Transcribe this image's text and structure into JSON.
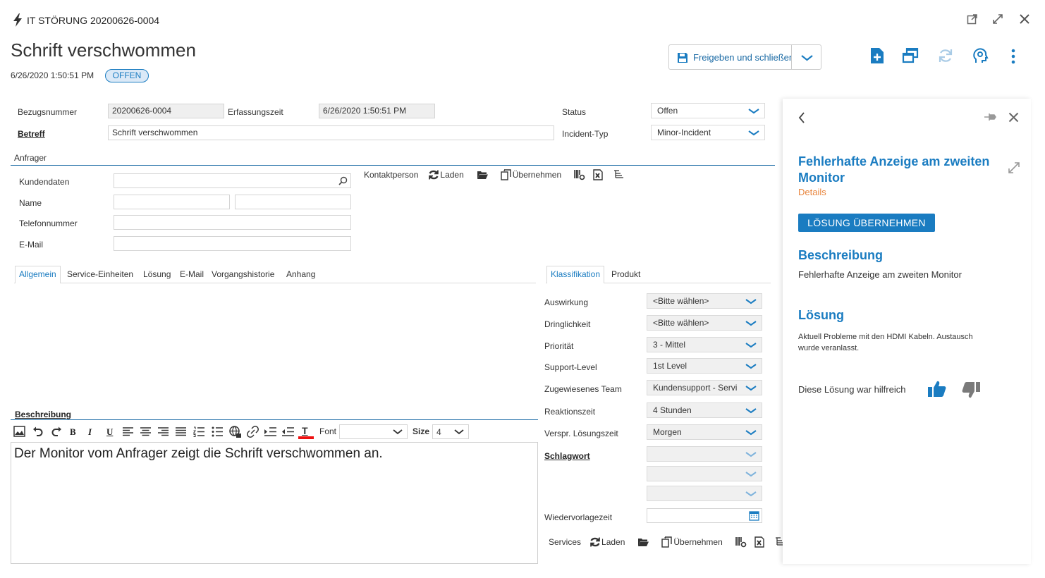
{
  "header": {
    "breadcrumb": "IT STÖRUNG 20200626-0004",
    "title": "Schrift verschwommen",
    "timestamp": "6/26/2020 1:50:51 PM",
    "status_badge": "OFFEN",
    "save_button": "Freigeben und schließen"
  },
  "colors": {
    "accent": "#1a7cc1",
    "badge_bg": "#dbe9f7",
    "badge_border": "#1a7cc1",
    "side_orange": "#e8853d"
  },
  "form": {
    "bezugsnummer_label": "Bezugsnummer",
    "bezugsnummer_value": "20200626-0004",
    "erfassungszeit_label": "Erfassungszeit",
    "erfassungszeit_value": "6/26/2020 1:50:51 PM",
    "betreff_label": "Betreff",
    "betreff_value": "Schrift verschwommen",
    "status_label": "Status",
    "status_value": "Offen",
    "incident_typ_label": "Incident-Typ",
    "incident_typ_value": "Minor-Incident"
  },
  "anfrager": {
    "section_label": "Anfrager",
    "kundendaten_label": "Kundendaten",
    "name_label": "Name",
    "telefon_label": "Telefonnummer",
    "email_label": "E-Mail",
    "kontakt_label": "Kontaktperson",
    "laden_label": "Laden",
    "uebernehmen_label": "Übernehmen"
  },
  "tabs_left": [
    "Allgemein",
    "Service-Einheiten",
    "Lösung",
    "E-Mail",
    "Vorgangshistorie",
    "Anhang"
  ],
  "tabs_right": [
    "Klassifikation",
    "Produkt"
  ],
  "beschreibung": {
    "label": "Beschreibung",
    "font_label": "Font",
    "size_label": "Size",
    "size_value": "4",
    "text": "Der Monitor vom Anfrager zeigt die Schrift verschwommen an."
  },
  "klassifikation": {
    "auswirkung_label": "Auswirkung",
    "auswirkung_value": "<Bitte wählen>",
    "dringlichkeit_label": "Dringlichkeit",
    "dringlichkeit_value": "<Bitte wählen>",
    "prioritaet_label": "Priorität",
    "prioritaet_value": "3 - Mittel",
    "support_label": "Support-Level",
    "support_value": "1st Level",
    "team_label": "Zugewiesenes Team",
    "team_value": "Kundensupport - Servi",
    "reaktion_label": "Reaktionszeit",
    "reaktion_value": "4 Stunden",
    "loesungszeit_label": "Verspr. Lösungszeit",
    "loesungszeit_value": "Morgen",
    "schlagwort_label": "Schlagwort",
    "wiedervorlage_label": "Wiedervorlagezeit",
    "services_label": "Services",
    "laden_label": "Laden",
    "uebernehmen_label": "Übernehmen"
  },
  "side": {
    "title": "Fehlerhafte Anzeige am zweiten Monitor",
    "details_link": "Details",
    "apply_button": "LÖSUNG ÜBERNEHMEN",
    "beschreibung_heading": "Beschreibung",
    "beschreibung_text": "Fehlerhafte Anzeige am zweiten Monitor",
    "loesung_heading": "Lösung",
    "loesung_text": "Aktuell Probleme mit den HDMI Kabeln. Austausch wurde veranlasst.",
    "helpful_label": "Diese Lösung war hilfreich"
  }
}
